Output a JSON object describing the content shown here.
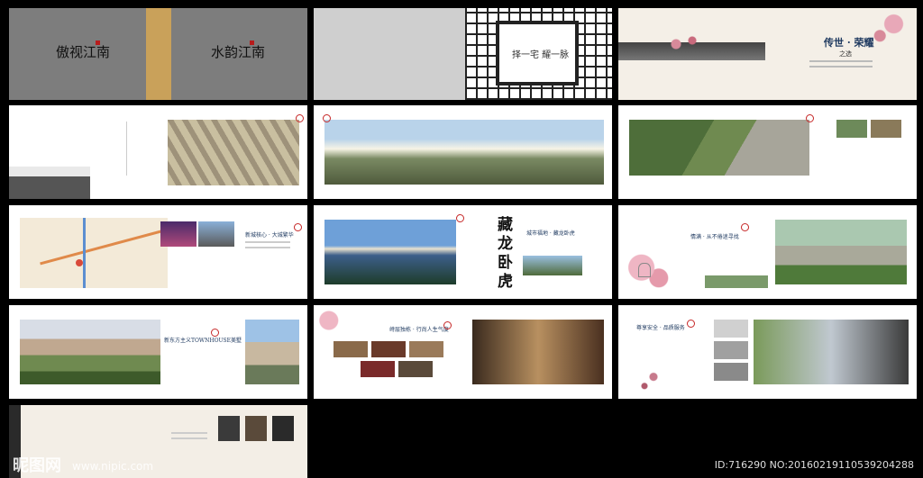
{
  "cover": {
    "left_title": "傲视江南",
    "right_title": "水韵江南"
  },
  "screen_panel": {
    "motto": "择一宅 耀一脉"
  },
  "intro_spread": {
    "title": "传世 · 荣耀",
    "subtitle": "之选"
  },
  "page3": {
    "heading": "新城核心 · 大城繁华"
  },
  "page4": {
    "calligraphy": "藏龙卧虎",
    "heading": "城市福地 · 藏龙卧虎"
  },
  "page5": {
    "heading": "情满 · 从不倦迷寻找"
  },
  "page6": {
    "heading": "新东方主义TOWNHOUSE美墅"
  },
  "page7": {
    "heading": "峙层独栋 · 行尚人生气度"
  },
  "page8": {
    "heading": "尊享安全 · 品质服务"
  },
  "watermark": {
    "brand": "昵图网",
    "url": "www.nipic.com"
  },
  "footer_id": "ID:716290 NO:20160219110539204288",
  "colors": {
    "background": "#000000",
    "accent_red": "#c62828",
    "gold_band": "#c9a15a",
    "paper": "#f3eee6"
  }
}
